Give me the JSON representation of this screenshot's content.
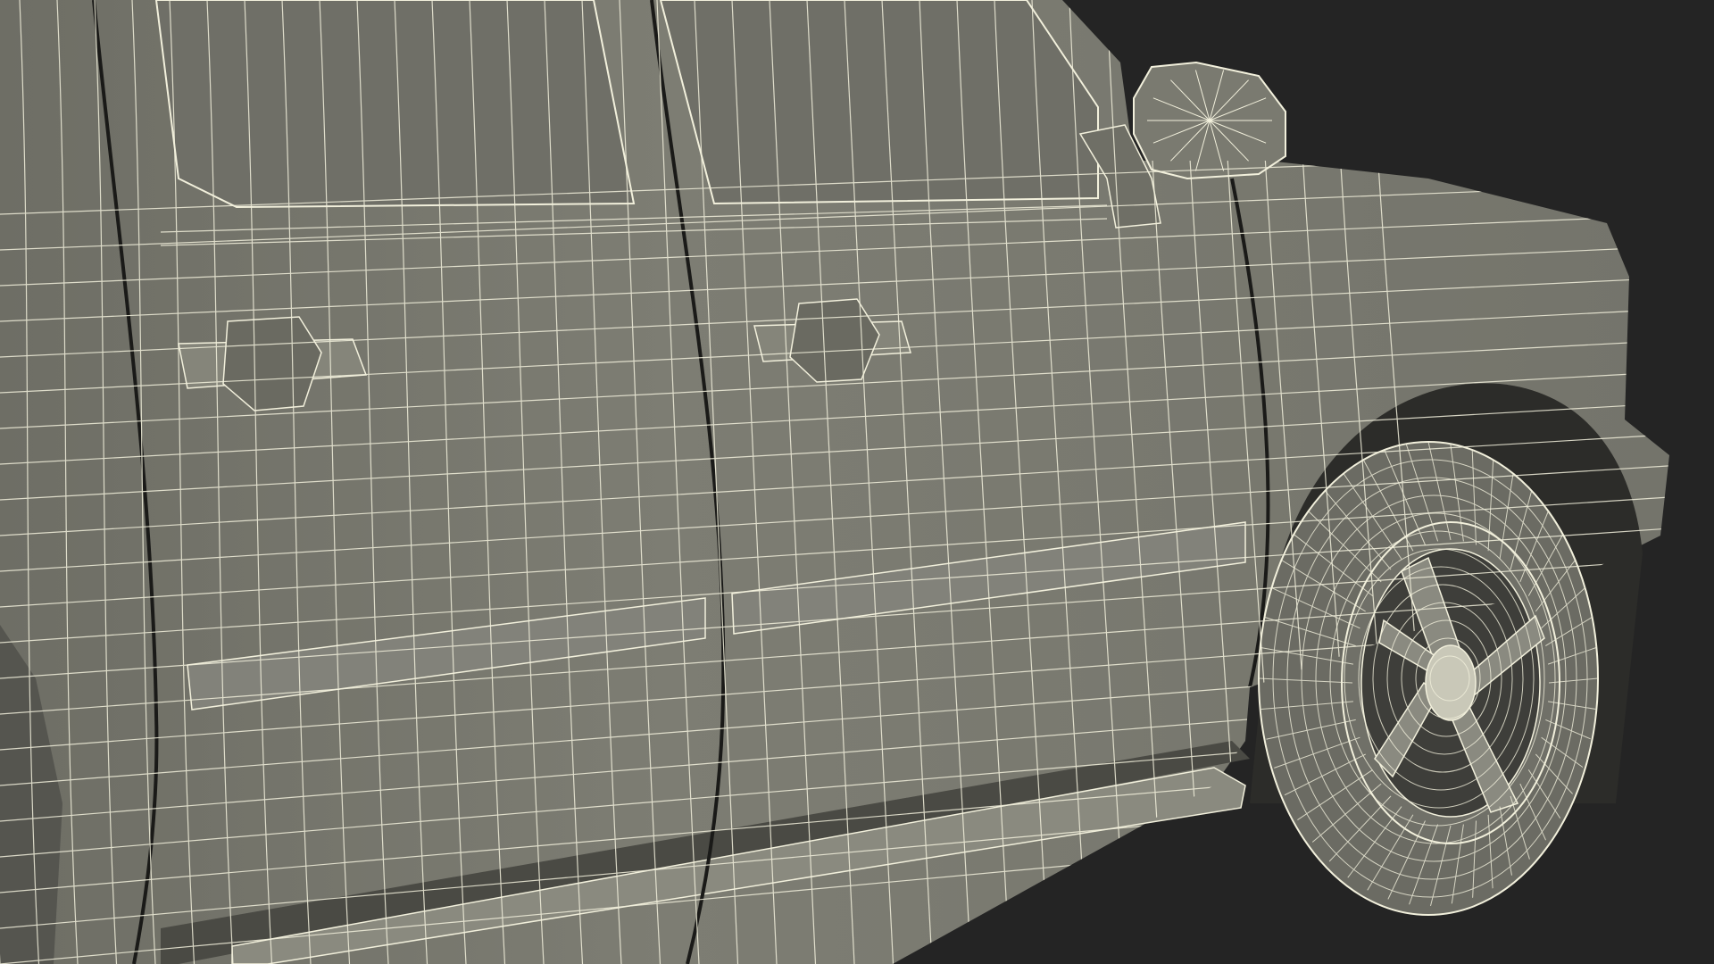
{
  "scene": {
    "subject": "pickup-truck-side-wireframe",
    "colors": {
      "background": "#242424",
      "body_fill": "#7b7b71",
      "body_shadow": "#5f5f57",
      "dark_recess": "#3a3a36",
      "wire": "#f2f0dc",
      "seam": "#1a1a18"
    }
  }
}
